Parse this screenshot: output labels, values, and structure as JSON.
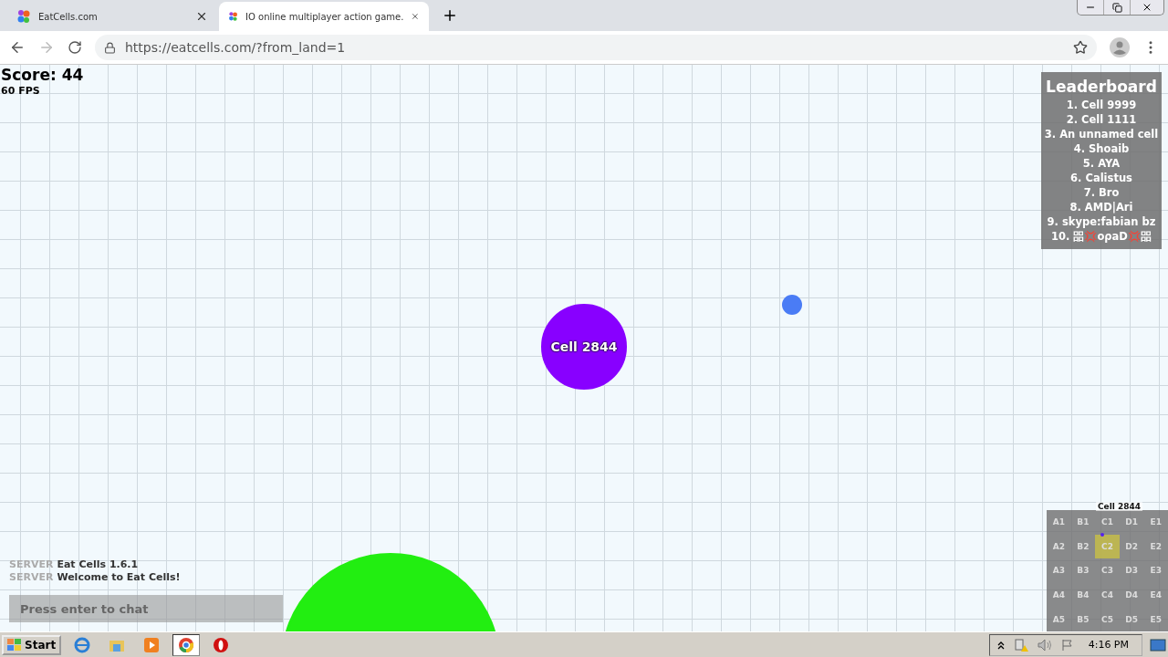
{
  "browser": {
    "tabs": [
      {
        "title": "EatCells.com",
        "selected": false
      },
      {
        "title": "IO online multiplayer action game.",
        "selected": true
      }
    ],
    "url": "https://eatcells.com/?from_land=1"
  },
  "game": {
    "score": "Score: 44",
    "fps": "60 FPS",
    "leaderboard": {
      "title": "Leaderboard",
      "entries": [
        "1. Cell 9999",
        "2. Cell 1111",
        "3. An unnamed cell",
        "4. Shoaib",
        "5. AYA",
        "6. Calistus",
        "7. Bro",
        "8. AMD|Ari",
        "9. skype:fabian bz",
        "10. 㗊💢ᴏρaD💢㗊"
      ]
    },
    "cells": [
      {
        "kind": "player",
        "label": "Cell 2844",
        "color": "#8800ff"
      },
      {
        "kind": "food",
        "color": "#4a7cf5"
      },
      {
        "kind": "player",
        "color": "#22ee11"
      }
    ],
    "chat": {
      "messages": [
        {
          "sender": "SERVER",
          "text": "Eat Cells 1.6.1"
        },
        {
          "sender": "SERVER",
          "text": "Welcome to Eat Cells!"
        }
      ],
      "placeholder": "Press enter to chat"
    },
    "minimap": {
      "player_label": "Cell 2844",
      "sectors": [
        {
          "label": "A1",
          "selected": false
        },
        {
          "label": "B1",
          "selected": false
        },
        {
          "label": "C1",
          "selected": false
        },
        {
          "label": "D1",
          "selected": false
        },
        {
          "label": "E1",
          "selected": false
        },
        {
          "label": "A2",
          "selected": false
        },
        {
          "label": "B2",
          "selected": false
        },
        {
          "label": "C2",
          "selected": true
        },
        {
          "label": "D2",
          "selected": false
        },
        {
          "label": "E2",
          "selected": false
        },
        {
          "label": "A3",
          "selected": false
        },
        {
          "label": "B3",
          "selected": false
        },
        {
          "label": "C3",
          "selected": false
        },
        {
          "label": "D3",
          "selected": false
        },
        {
          "label": "E3",
          "selected": false
        },
        {
          "label": "A4",
          "selected": false
        },
        {
          "label": "B4",
          "selected": false
        },
        {
          "label": "C4",
          "selected": false
        },
        {
          "label": "D4",
          "selected": false
        },
        {
          "label": "E4",
          "selected": false
        },
        {
          "label": "A5",
          "selected": false
        },
        {
          "label": "B5",
          "selected": false
        },
        {
          "label": "C5",
          "selected": false
        },
        {
          "label": "D5",
          "selected": false
        },
        {
          "label": "E5",
          "selected": false
        }
      ]
    }
  },
  "taskbar": {
    "start": "Start",
    "time": "4:16 PM"
  }
}
